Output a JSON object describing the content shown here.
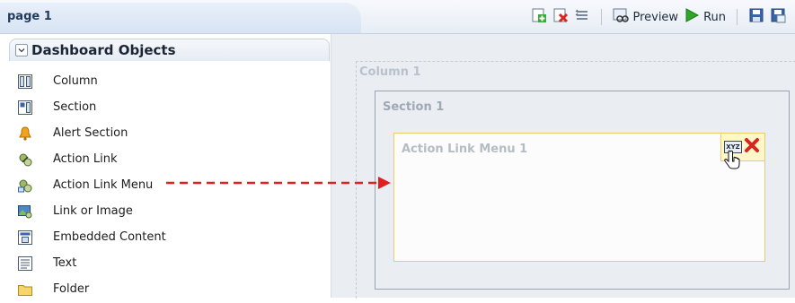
{
  "tab": {
    "title": "page 1"
  },
  "toolbar": {
    "preview_label": "Preview",
    "run_label": "Run"
  },
  "left_panel": {
    "title": "Dashboard Objects",
    "items": [
      {
        "label": "Column",
        "icon": "column-icon"
      },
      {
        "label": "Section",
        "icon": "section-icon"
      },
      {
        "label": "Alert Section",
        "icon": "bell-icon"
      },
      {
        "label": "Action Link",
        "icon": "action-link-icon"
      },
      {
        "label": "Action Link Menu",
        "icon": "action-link-menu-icon"
      },
      {
        "label": "Link or Image",
        "icon": "link-image-icon"
      },
      {
        "label": "Embedded Content",
        "icon": "embedded-content-icon"
      },
      {
        "label": "Text",
        "icon": "text-icon"
      },
      {
        "label": "Folder",
        "icon": "folder-icon"
      }
    ]
  },
  "canvas": {
    "column_label": "Column 1",
    "section_label": "Section 1",
    "action_link_menu_label": "Action Link Menu 1",
    "properties_icon_text": "XYZ"
  },
  "colors": {
    "arrow": "#e02020",
    "highlight_border": "#e8cf6a",
    "run_green": "#2fa52a"
  }
}
